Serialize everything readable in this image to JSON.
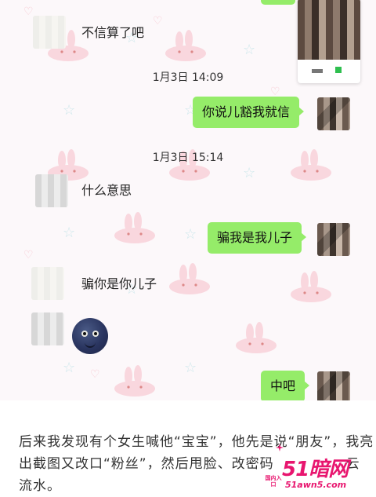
{
  "chat": {
    "timestamps": [
      "1月3日 14:09",
      "1月3日 15:14"
    ],
    "incoming": [
      "不信算了吧",
      "什么意思",
      "骗你是你儿子"
    ],
    "outgoing": [
      "你说儿豁我就信",
      "骗我是我儿子",
      "中吧"
    ],
    "emoji_icon": "black-round-face-emoji-icon",
    "bubble_color": "#95ec69",
    "background_color": "#fcf8fa"
  },
  "caption": {
    "line1": "后来我发现有个女生喊他“宝宝”，他先是说“朋友”，我亮",
    "line2": "出截图又改口“粉丝”，然后甩脸、改密码",
    "line3": "云",
    "line4": "流水。"
  },
  "watermark": {
    "logo": "51暗网",
    "url": "51awn5.com",
    "badge": "国内入口",
    "color": "#e8166f"
  }
}
